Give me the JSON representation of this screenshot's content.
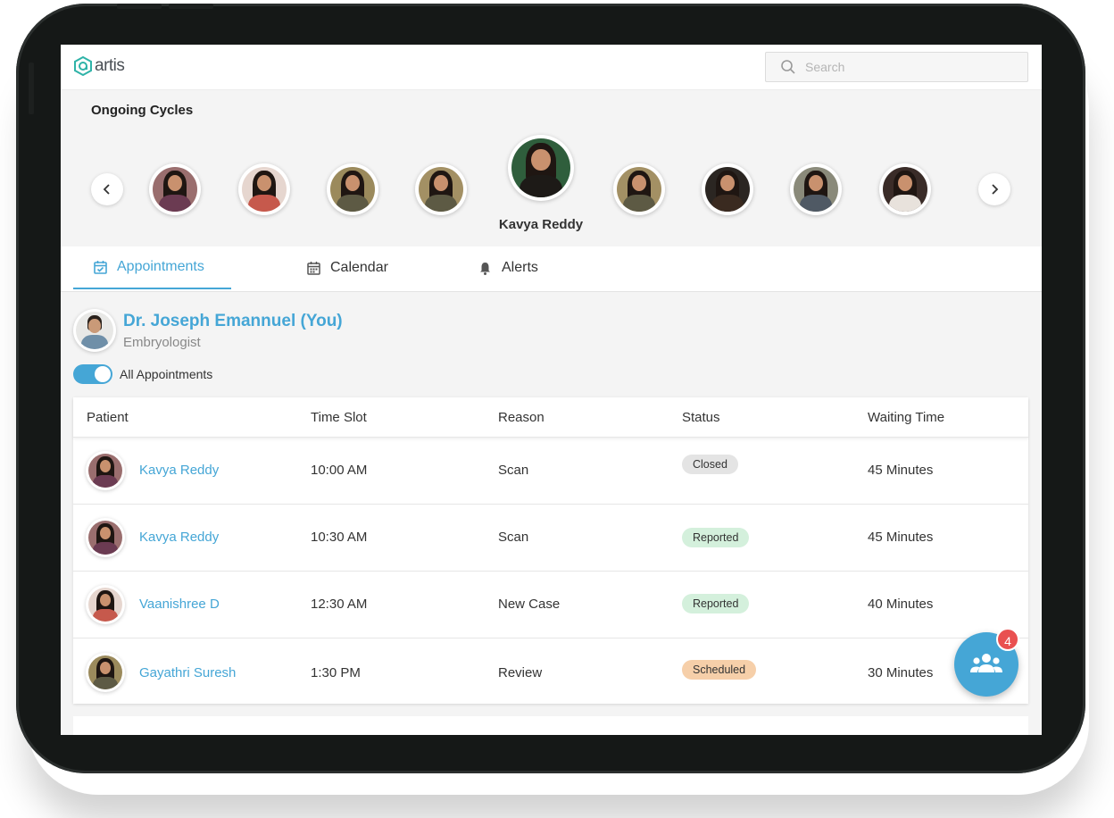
{
  "app": {
    "logo_text": "artis",
    "search": {
      "placeholder": "Search"
    }
  },
  "cycles": {
    "title": "Ongoing Cycles",
    "featured_name": "Kavya Reddy",
    "avatars": [
      {
        "shirt": "#6b3b52",
        "bg": "#9a6e6e"
      },
      {
        "shirt": "#c6594c",
        "bg": "#e6d6cf"
      },
      {
        "shirt": "#5d5a44",
        "bg": "#9b8a5c"
      },
      {
        "shirt": "#5d5a44",
        "bg": "#a39064"
      },
      {
        "shirt": "#1d1a17",
        "bg": "#2f5e3c"
      },
      {
        "shirt": "#5d5a44",
        "bg": "#a39064"
      },
      {
        "shirt": "#3a2a20",
        "bg": "#2b2622"
      },
      {
        "shirt": "#4f5964",
        "bg": "#8a8a7a"
      },
      {
        "shirt": "#e8e2dc",
        "bg": "#3a2c28"
      }
    ]
  },
  "tabs": [
    {
      "label": "Appointments",
      "icon": "calendar-check-icon",
      "active": true
    },
    {
      "label": "Calendar",
      "icon": "calendar-icon",
      "active": false
    },
    {
      "label": "Alerts",
      "icon": "bell-icon",
      "active": false
    }
  ],
  "doctor": {
    "name": "Dr. Joseph Emannuel (You)",
    "role": "Embryologist",
    "toggle_label": "All Appointments",
    "toggle_on": true
  },
  "table": {
    "columns": [
      "Patient",
      "Time Slot",
      "Reason",
      "Status",
      "Waiting Time"
    ],
    "rows": [
      {
        "patient": "Kavya Reddy",
        "time": "10:00 AM",
        "reason": "Scan",
        "status": "Closed",
        "wait": "45 Minutes"
      },
      {
        "patient": "Kavya Reddy",
        "time": "10:30 AM",
        "reason": "Scan",
        "status": "Reported",
        "wait": "45 Minutes"
      },
      {
        "patient": "Vaanishree D",
        "time": "12:30 AM",
        "reason": "New Case",
        "status": "Reported",
        "wait": "40 Minutes"
      },
      {
        "patient": "Gayathri Suresh",
        "time": "1:30 PM",
        "reason": "Review",
        "status": "Scheduled",
        "wait": "30 Minutes"
      }
    ]
  },
  "status_colors": {
    "Closed": "#e4e4e4",
    "Reported": "#d4f0dc",
    "Scheduled": "#f6cfa9"
  },
  "fab": {
    "icon": "group-icon",
    "badge_count": "4"
  },
  "colors": {
    "accent": "#45a6d6",
    "badge_red": "#e95050"
  }
}
